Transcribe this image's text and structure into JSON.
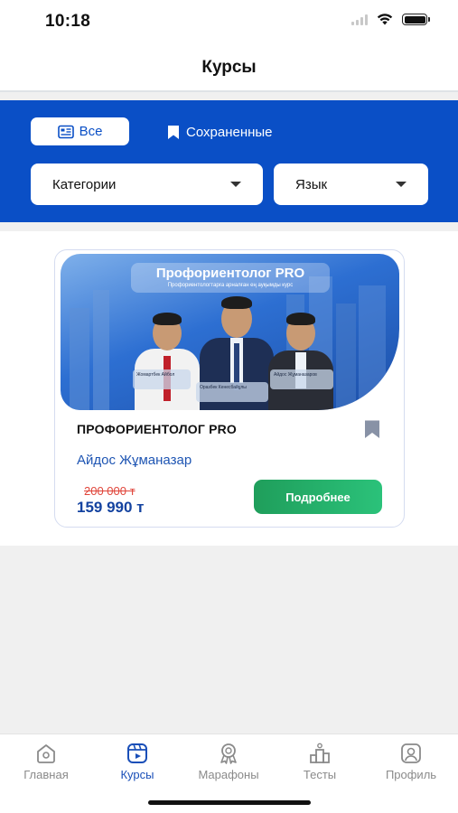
{
  "status_bar": {
    "time": "10:18"
  },
  "header": {
    "title": "Курсы"
  },
  "filters": {
    "tab_all": "Все",
    "tab_saved": "Сохраненные",
    "category_dropdown": "Категории",
    "language_dropdown": "Язык"
  },
  "course_card": {
    "banner_title": "Профориентолог PRO",
    "banner_subtitle": "Профориентологтарға арналған ең ауқымды курс",
    "banner_names": [
      "Жомартбек Айбол",
      "Оразбек Кенесбайұлы",
      "Айдос Жұманазаров"
    ],
    "title": "ПРОФОРИЕНТОЛОГ PRO",
    "author": "Айдос Жұманазар",
    "old_price": "200 000 т",
    "price": "159 990 т",
    "details_button": "Подробнее"
  },
  "tab_bar": {
    "items": [
      {
        "label": "Главная",
        "icon": "home-icon"
      },
      {
        "label": "Курсы",
        "icon": "courses-icon"
      },
      {
        "label": "Марафоны",
        "icon": "medal-icon"
      },
      {
        "label": "Тесты",
        "icon": "tests-icon"
      },
      {
        "label": "Профиль",
        "icon": "profile-icon"
      }
    ],
    "active_index": 1
  },
  "colors": {
    "primary_blue": "#0a4fc6",
    "accent_green": "#2bc27a",
    "old_price_red": "#e0463b"
  }
}
